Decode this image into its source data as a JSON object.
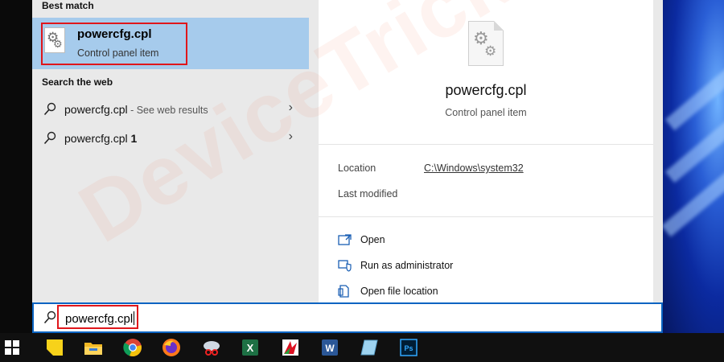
{
  "best_match": {
    "section_label": "Best match",
    "title": "powercfg.cpl",
    "subtitle": "Control panel item"
  },
  "search_web": {
    "section_label": "Search the web",
    "items": [
      {
        "query": "powercfg.cpl",
        "suffix": " - See web results"
      },
      {
        "query": "powercfg.cpl",
        "suffix": " 1"
      }
    ]
  },
  "preview": {
    "title": "powercfg.cpl",
    "subtitle": "Control panel item",
    "location_label": "Location",
    "location_value": "C:\\Windows\\system32",
    "last_modified_label": "Last modified",
    "actions": [
      {
        "label": "Open",
        "icon": "open-window-icon"
      },
      {
        "label": "Run as administrator",
        "icon": "shield-icon"
      },
      {
        "label": "Open file location",
        "icon": "file-location-icon"
      }
    ]
  },
  "search": {
    "value": "powercfg.cpl"
  },
  "watermark": "DeviceTricks",
  "taskbar": {
    "icons": [
      "windows-start-icon",
      "sticky-notes-icon",
      "file-explorer-icon",
      "chrome-icon",
      "firefox-icon",
      "snipping-tool-icon",
      "excel-icon",
      "wps-icon",
      "word-icon",
      "notepad-icon",
      "photoshop-icon"
    ]
  },
  "colors": {
    "selection": "#a6cbec",
    "highlight_box": "#e0161b",
    "search_border": "#0a64c2",
    "panel_bg": "#e9e9e9",
    "taskbar_bg": "#101010"
  }
}
